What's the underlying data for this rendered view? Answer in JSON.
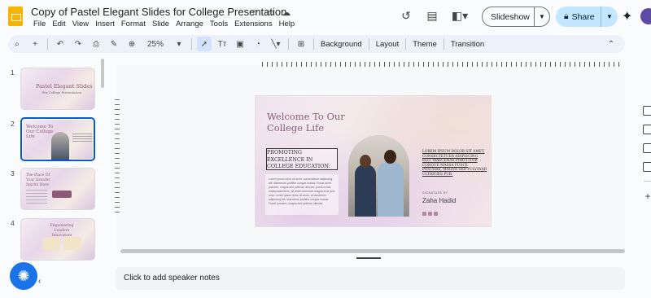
{
  "app": {
    "title": "Copy of Pastel Elegant Slides for College Presentation",
    "menu": [
      "File",
      "Edit",
      "View",
      "Insert",
      "Format",
      "Slide",
      "Arrange",
      "Tools",
      "Extensions",
      "Help"
    ],
    "slideshow_label": "Slideshow",
    "share_label": "Share"
  },
  "toolbar": {
    "zoom": "25%",
    "background_label": "Background",
    "layout_label": "Layout",
    "theme_label": "Theme",
    "transition_label": "Transition"
  },
  "filmstrip": {
    "slides": [
      {
        "number": "1",
        "title": "Pastel Elegant Slides",
        "subtitle": "For College Presentation"
      },
      {
        "number": "2",
        "title": "Welcome To Our College Life"
      },
      {
        "number": "3",
        "title": "The Place Of Your Greater Spirits Here"
      },
      {
        "number": "4",
        "title": "Empowering Leaders Innovators"
      }
    ]
  },
  "slide": {
    "title_line1": "Welcome To Our",
    "title_line2": "College Life",
    "subtitle_line1": "PROMOTING",
    "subtitle_line2": "EXCELLENCE IN",
    "subtitle_line3": "COLLEGE EDUCATION:",
    "body": "Lorem ipsum dolor sit amet, consectetuer adipiscing elit. Maecenas porttitor congue massa. Fusce amet posuere, magna sed pulvinar ultricies, purus lectus malesuada libero, sit amet commodo magna eros quis urna. Lorem ipsum dolor sit amet, consectetuer adipiscing elit. Maecenas porttitor congue massa. Fusce posuere, magna sed pulvinar ultricies.",
    "right_text": "LOREM IPSUM DOLOR SIT AMET, CONSECTETUER ADIPISCING ELIT. MAECENAS PORTTITOR CONGUE MASSA FUSCE POSUERE, MAGNA SED PULVINAR ULTRICIES PUR.",
    "signature_label": "SIGNATURE BY",
    "signature_name": "Zaha Hadid"
  },
  "notes": {
    "placeholder": "Click to add speaker notes"
  }
}
